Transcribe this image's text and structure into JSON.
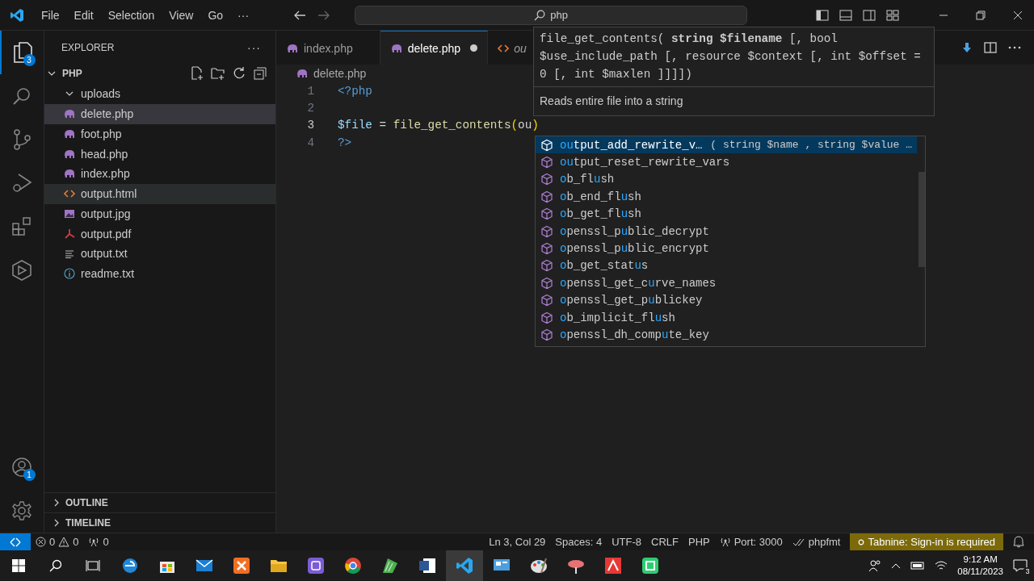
{
  "title_bar": {
    "menu": [
      "File",
      "Edit",
      "Selection",
      "View",
      "Go",
      "···"
    ],
    "search": {
      "value": "php"
    }
  },
  "activity_bar": {
    "explorer_badge": "3",
    "accounts_badge": "1"
  },
  "sidebar": {
    "title": "EXPLORER",
    "more": "···",
    "folder": {
      "name": "PHP",
      "expanded": true
    },
    "tree": [
      {
        "name": "uploads",
        "kind": "folder",
        "expanded": true,
        "selected": false,
        "hovered": false
      },
      {
        "name": "delete.php",
        "kind": "php",
        "selected": true,
        "hovered": false
      },
      {
        "name": "foot.php",
        "kind": "php",
        "selected": false,
        "hovered": false
      },
      {
        "name": "head.php",
        "kind": "php",
        "selected": false,
        "hovered": false
      },
      {
        "name": "index.php",
        "kind": "php",
        "selected": false,
        "hovered": false
      },
      {
        "name": "output.html",
        "kind": "html",
        "selected": false,
        "hovered": true
      },
      {
        "name": "output.jpg",
        "kind": "image",
        "selected": false,
        "hovered": false
      },
      {
        "name": "output.pdf",
        "kind": "pdf",
        "selected": false,
        "hovered": false
      },
      {
        "name": "output.txt",
        "kind": "text",
        "selected": false,
        "hovered": false
      },
      {
        "name": "readme.txt",
        "kind": "info",
        "selected": false,
        "hovered": false
      }
    ],
    "sections": [
      {
        "name": "OUTLINE",
        "expanded": false
      },
      {
        "name": "TIMELINE",
        "expanded": false
      }
    ]
  },
  "tabs": [
    {
      "label": "index.php",
      "kind": "php",
      "selected": false,
      "modified": false,
      "preview": false
    },
    {
      "label": "delete.php",
      "kind": "php",
      "selected": true,
      "modified": true,
      "preview": false
    },
    {
      "label": "ou",
      "kind": "html",
      "selected": false,
      "modified": false,
      "preview": true
    }
  ],
  "breadcrumb": {
    "file": "delete.php",
    "kind": "php"
  },
  "code": {
    "lines": [
      {
        "number": "1",
        "current": false,
        "tokens": [
          {
            "text": "<?php",
            "kind": "tag"
          }
        ]
      },
      {
        "number": "2",
        "current": false
      },
      {
        "number": "3",
        "current": true,
        "tokens": [
          {
            "text": "$file",
            "kind": "variable"
          },
          {
            "text": " = ",
            "kind": "operator"
          },
          {
            "text": "file_get_contents",
            "kind": "function"
          },
          {
            "text": "(",
            "kind": "bracket"
          },
          {
            "text": "ou",
            "kind": "plain"
          },
          {
            "text": ")",
            "kind": "bracket"
          }
        ]
      },
      {
        "number": "4",
        "current": false,
        "tokens": [
          {
            "text": "?>",
            "kind": "tag"
          }
        ]
      }
    ]
  },
  "hover": {
    "signature": "file_get_contents( **string $filename** [, bool $use_include_path [, resource $context [, int $offset = 0 [, int $maxlen ]]]])",
    "description": "Reads entire file into a string"
  },
  "suggestions": [
    {
      "selected": true,
      "detail": "( string $name , string $value …",
      "parts": [
        {
          "text": "ou",
          "match": true
        },
        {
          "text": "tput_add_rewrite_v…",
          "match": false
        }
      ]
    },
    {
      "selected": false,
      "parts": [
        {
          "text": "ou",
          "match": true
        },
        {
          "text": "tput_reset_rewrite_vars",
          "match": false
        }
      ]
    },
    {
      "selected": false,
      "parts": [
        {
          "text": "o",
          "match": true
        },
        {
          "text": "b_fl",
          "match": false
        },
        {
          "text": "u",
          "match": true
        },
        {
          "text": "sh",
          "match": false
        }
      ]
    },
    {
      "selected": false,
      "parts": [
        {
          "text": "o",
          "match": true
        },
        {
          "text": "b_end_fl",
          "match": false
        },
        {
          "text": "u",
          "match": true
        },
        {
          "text": "sh",
          "match": false
        }
      ]
    },
    {
      "selected": false,
      "parts": [
        {
          "text": "o",
          "match": true
        },
        {
          "text": "b_get_fl",
          "match": false
        },
        {
          "text": "u",
          "match": true
        },
        {
          "text": "sh",
          "match": false
        }
      ]
    },
    {
      "selected": false,
      "parts": [
        {
          "text": "o",
          "match": true
        },
        {
          "text": "penssl_p",
          "match": false
        },
        {
          "text": "u",
          "match": true
        },
        {
          "text": "blic_decrypt",
          "match": false
        }
      ]
    },
    {
      "selected": false,
      "parts": [
        {
          "text": "o",
          "match": true
        },
        {
          "text": "penssl_p",
          "match": false
        },
        {
          "text": "u",
          "match": true
        },
        {
          "text": "blic_encrypt",
          "match": false
        }
      ]
    },
    {
      "selected": false,
      "parts": [
        {
          "text": "o",
          "match": true
        },
        {
          "text": "b_get_stat",
          "match": false
        },
        {
          "text": "u",
          "match": true
        },
        {
          "text": "s",
          "match": false
        }
      ]
    },
    {
      "selected": false,
      "parts": [
        {
          "text": "o",
          "match": true
        },
        {
          "text": "penssl_get_c",
          "match": false
        },
        {
          "text": "u",
          "match": true
        },
        {
          "text": "rve_names",
          "match": false
        }
      ]
    },
    {
      "selected": false,
      "parts": [
        {
          "text": "o",
          "match": true
        },
        {
          "text": "penssl_get_p",
          "match": false
        },
        {
          "text": "u",
          "match": true
        },
        {
          "text": "blickey",
          "match": false
        }
      ]
    },
    {
      "selected": false,
      "parts": [
        {
          "text": "o",
          "match": true
        },
        {
          "text": "b_implicit_fl",
          "match": false
        },
        {
          "text": "u",
          "match": true
        },
        {
          "text": "sh",
          "match": false
        }
      ]
    },
    {
      "selected": false,
      "parts": [
        {
          "text": "o",
          "match": true
        },
        {
          "text": "penssl_dh_comp",
          "match": false
        },
        {
          "text": "u",
          "match": true
        },
        {
          "text": "te_key",
          "match": false
        }
      ]
    }
  ],
  "status_bar": {
    "errors": "0",
    "warnings": "0",
    "ports": "0",
    "items": [
      {
        "text": "Ln 3, Col 29",
        "kind": "plain"
      },
      {
        "text": "Spaces: 4",
        "kind": "plain"
      },
      {
        "text": "UTF-8",
        "kind": "plain"
      },
      {
        "text": "CRLF",
        "kind": "plain"
      },
      {
        "text": "PHP",
        "kind": "plain"
      },
      {
        "text": "Port: 3000",
        "kind": "port"
      },
      {
        "text": "phpfmt",
        "kind": "check"
      }
    ],
    "tabnine": {
      "text": "Tabnine: Sign-in is required",
      "warning": true
    }
  },
  "taskbar": {
    "time": "9:12 AM",
    "date": "08/11/2023",
    "notifications": "3"
  }
}
